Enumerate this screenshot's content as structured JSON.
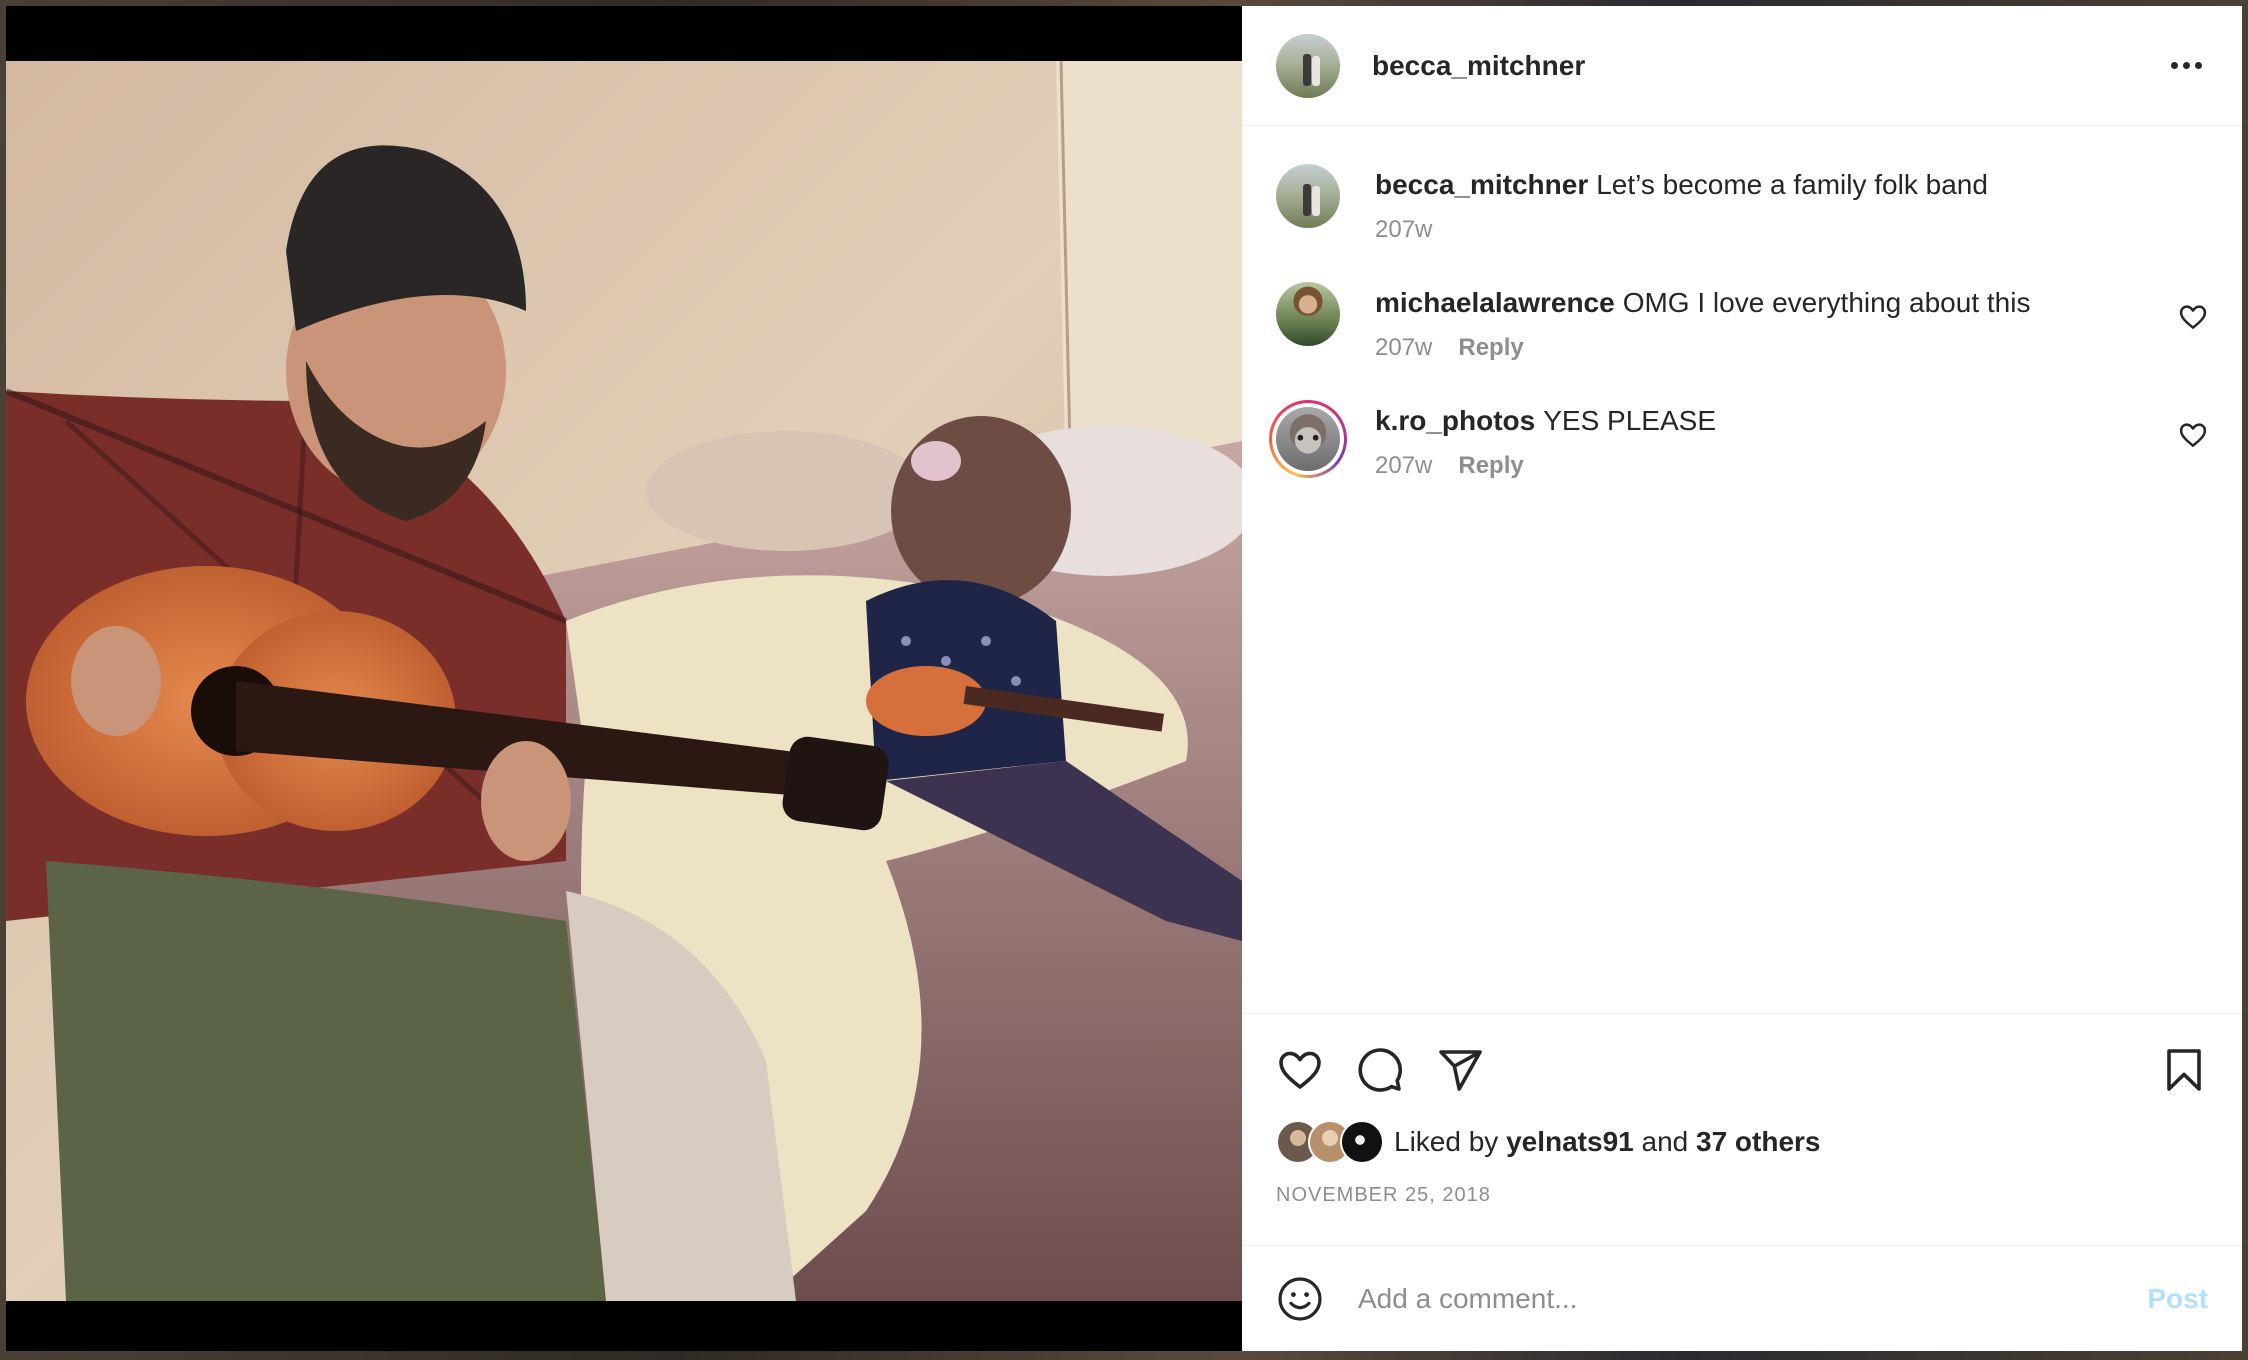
{
  "post": {
    "author": "becca_mitchner",
    "caption_user": "becca_mitchner",
    "caption_text": "Let’s become a family folk band",
    "caption_age": "207w",
    "date": "NOVEMBER 25, 2018"
  },
  "comments": [
    {
      "user": "michaelalawrence",
      "text": "OMG I love everything about this",
      "age": "207w",
      "reply_label": "Reply"
    },
    {
      "user": "k.ro_photos",
      "text": "YES PLEASE",
      "age": "207w",
      "reply_label": "Reply"
    }
  ],
  "likes": {
    "prefix": "Liked by",
    "user": "yelnats91",
    "joiner": "and",
    "others": "37 others"
  },
  "comment_box": {
    "placeholder": "Add a comment...",
    "post_label": "Post"
  },
  "colors": {
    "post_button_disabled": "#b2dffc",
    "muted_text": "#8e8e8e",
    "primary_text": "#262626",
    "story_ring": [
      "#fdc04b",
      "#e1306c",
      "#833ab4"
    ]
  },
  "icons": {
    "header_more": "more-horizontal-icon",
    "like": "heart-outline-icon",
    "comment": "comment-bubble-icon",
    "share": "paper-plane-icon",
    "save": "bookmark-icon",
    "comment_like": "small-heart-icon",
    "emoji": "emoji-smile-icon"
  }
}
